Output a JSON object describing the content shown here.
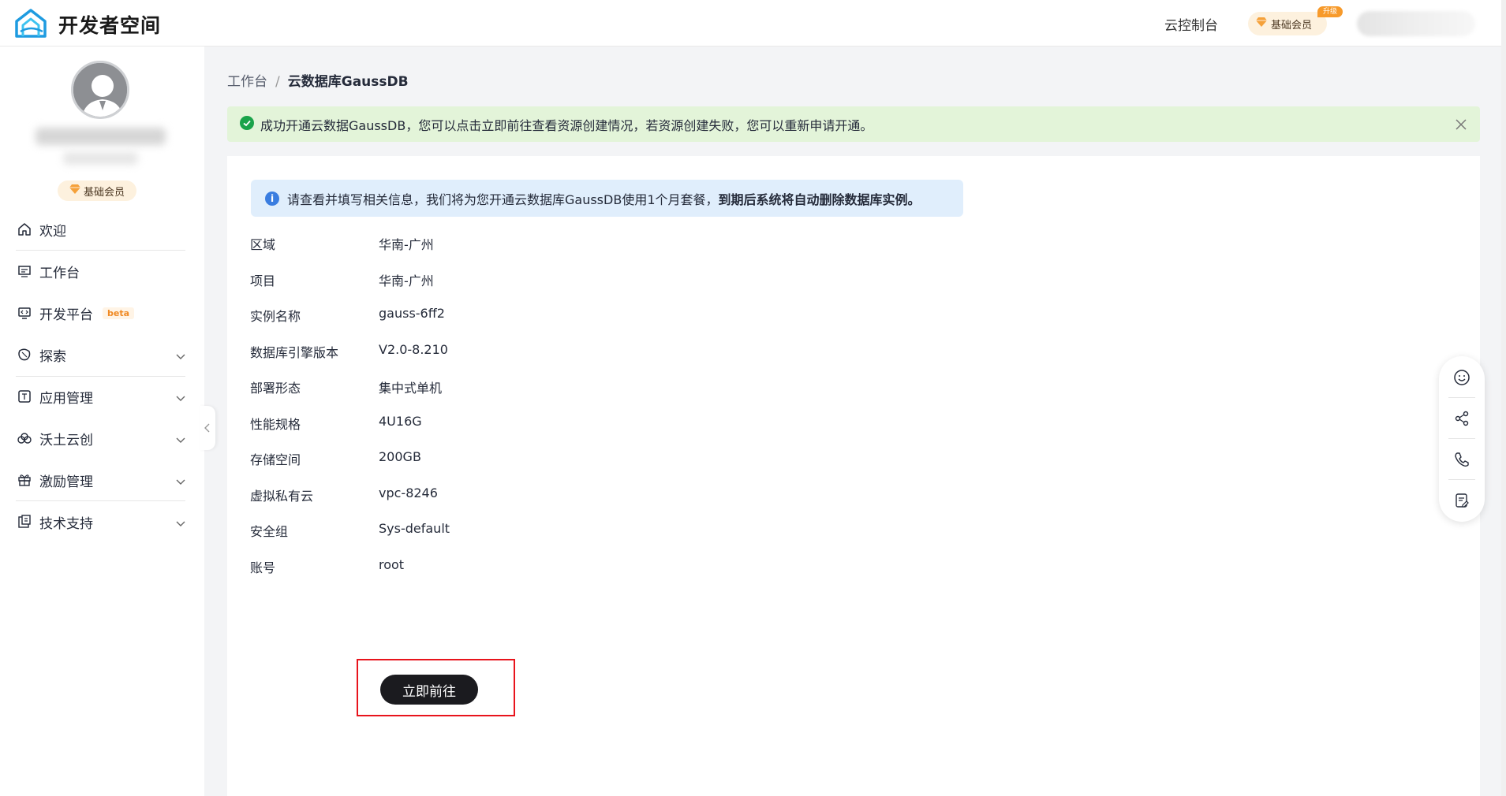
{
  "header": {
    "brand": "开发者空间",
    "console_link": "云控制台",
    "member_badge": "基础会员",
    "upgrade_tag": "升级"
  },
  "sidebar": {
    "member_badge": "基础会员",
    "items": [
      {
        "label": "欢迎",
        "icon": "home-icon"
      },
      {
        "label": "工作台",
        "icon": "monitor-icon"
      },
      {
        "label": "开发平台",
        "icon": "code-screen-icon",
        "tag": "beta"
      },
      {
        "label": "探索",
        "icon": "compass-icon"
      },
      {
        "label": "应用管理",
        "icon": "app-icon"
      },
      {
        "label": "沃土云创",
        "icon": "cloud-icon"
      },
      {
        "label": "激励管理",
        "icon": "gift-icon"
      },
      {
        "label": "技术支持",
        "icon": "support-icon"
      }
    ]
  },
  "breadcrumb": {
    "parent": "工作台",
    "separator": "/",
    "current": "云数据库GaussDB"
  },
  "success_alert": {
    "message": "成功开通云数据GaussDB，您可以点击立即前往查看资源创建情况，若资源创建失败，您可以重新申请开通。"
  },
  "info_tip": {
    "prefix": "请查看并填写相关信息，我们将为您开通云数据库GaussDB使用1个月套餐，",
    "bold": "到期后系统将自动删除数据库实例。"
  },
  "fields": [
    {
      "label": "区域",
      "value": "华南-广州"
    },
    {
      "label": "项目",
      "value": "华南-广州"
    },
    {
      "label": "实例名称",
      "value": "gauss-6ff2"
    },
    {
      "label": "数据库引擎版本",
      "value": "V2.0-8.210"
    },
    {
      "label": "部署形态",
      "value": "集中式单机"
    },
    {
      "label": "性能规格",
      "value": "4U16G"
    },
    {
      "label": "存储空间",
      "value": "200GB"
    },
    {
      "label": "虚拟私有云",
      "value": "vpc-8246"
    },
    {
      "label": "安全组",
      "value": "Sys-default"
    },
    {
      "label": "账号",
      "value": "root"
    }
  ],
  "actions": {
    "go_now": "立即前往"
  },
  "colors": {
    "success_bg": "#e3f4d9",
    "info_bg": "#e0eefc",
    "primary_button": "#1b1b1f",
    "highlight": "#e8141c",
    "member_badge_bg": "#fdf1de"
  }
}
